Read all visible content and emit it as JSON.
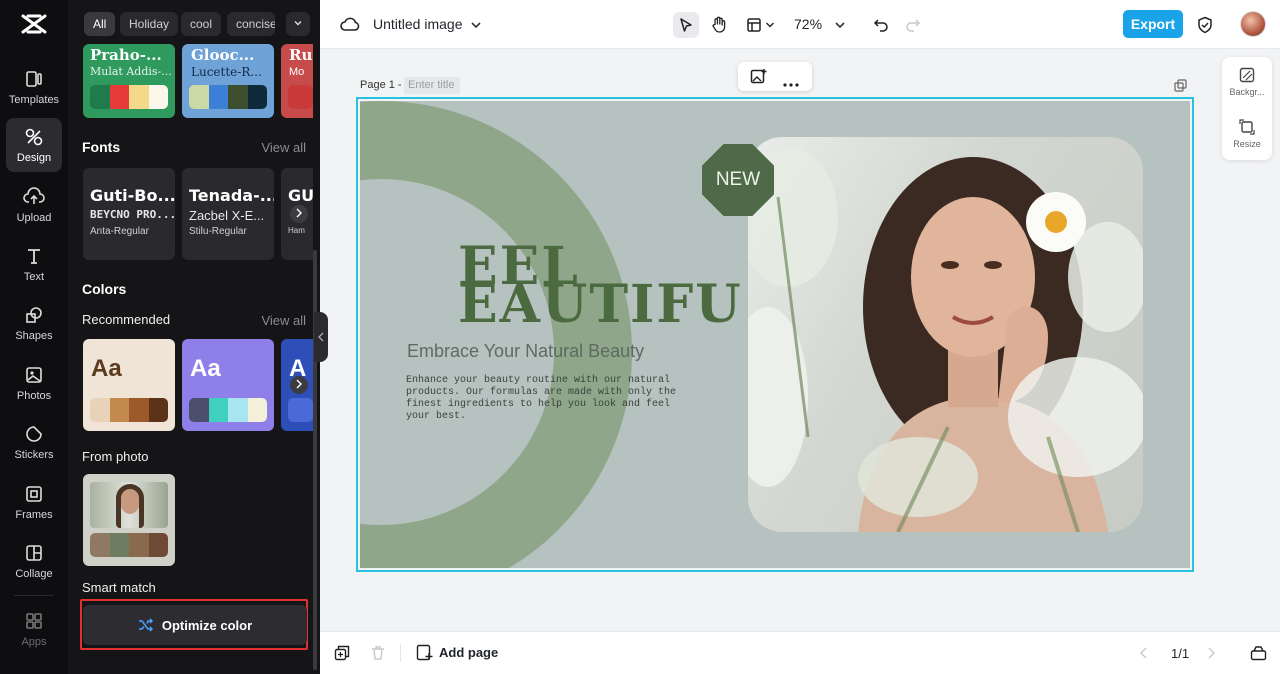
{
  "rail": {
    "items": [
      {
        "label": "Templates",
        "icon": "templates-icon"
      },
      {
        "label": "Design",
        "icon": "design-icon"
      },
      {
        "label": "Upload",
        "icon": "upload-icon"
      },
      {
        "label": "Text",
        "icon": "text-icon"
      },
      {
        "label": "Shapes",
        "icon": "shapes-icon"
      },
      {
        "label": "Photos",
        "icon": "photos-icon"
      },
      {
        "label": "Stickers",
        "icon": "stickers-icon"
      },
      {
        "label": "Frames",
        "icon": "frames-icon"
      },
      {
        "label": "Collage",
        "icon": "collage-icon"
      },
      {
        "label": "Apps",
        "icon": "apps-icon"
      }
    ],
    "active": "Design"
  },
  "panel": {
    "chips": [
      "All",
      "Holiday",
      "cool",
      "concise"
    ],
    "theme_cards": [
      {
        "font": "Praho-...",
        "sub": "Mulat Addis-...",
        "bg": "#2f9a5d",
        "swatches": [
          "#1f7a4c",
          "#e63b3b",
          "#f5d98a",
          "#fbf7ea"
        ]
      },
      {
        "font": "Glooc...",
        "sub": "Lucette-R...",
        "bg": "#6fa3d8",
        "swatches": [
          "#cbd9a6",
          "#3c7fd6",
          "#3e4f2f",
          "#0f2a3b"
        ]
      },
      {
        "font": "Ru",
        "sub": "Mo",
        "bg": "#c84b4b",
        "swatches": [
          "#c93a3a"
        ]
      }
    ],
    "fonts": {
      "title": "Fonts",
      "view_all": "View all",
      "cards": [
        {
          "line1": "Guti-Bo...",
          "line2": "BEYCNO PRO...",
          "line3": "Anta-Regular"
        },
        {
          "line1": "Tenada-...",
          "line2": "Zacbel X-E...",
          "line3": "Stilu-Regular"
        },
        {
          "line1": "GU",
          "line2": "",
          "line3": "Ham"
        }
      ]
    },
    "colors": {
      "title": "Colors",
      "recommended": "Recommended",
      "view_all": "View all",
      "cards": [
        {
          "label": "Aa",
          "bg": "#efe4d6",
          "fg": "#5b3a1e",
          "swatches": [
            "#e8d3b8",
            "#c48a4d",
            "#9c5a2b",
            "#5c3218"
          ]
        },
        {
          "label": "Aa",
          "bg": "#8f7fe8",
          "fg": "#ffffff",
          "swatches": [
            "#4b4f6b",
            "#3fd0c0",
            "#a8e6ef",
            "#f3efd8"
          ]
        },
        {
          "label": "A",
          "bg": "#2f4fb8",
          "fg": "#ffffff",
          "swatches": [
            "#4a6ad8"
          ]
        }
      ]
    },
    "from_photo": {
      "title": "From photo",
      "swatches": [
        "#8e7a63",
        "#6e7c62",
        "#8a6a4c",
        "#6e4a34"
      ]
    },
    "smart_match": {
      "title": "Smart match",
      "button": "Optimize color"
    }
  },
  "topbar": {
    "doc_title": "Untitled image",
    "zoom": "72%",
    "export": "Export"
  },
  "canvas_area": {
    "page_label": "Page 1 -",
    "title_placeholder": "Enter title",
    "side_tools": [
      "Backgr...",
      "Resize"
    ]
  },
  "design": {
    "badge": "NEW",
    "headline_1": "EEL",
    "headline_2": "EAUTIFU",
    "subtitle": "Embrace Your Natural Beauty",
    "paragraph": "Enhance your beauty routine with our natural products. Our formulas are made with only the finest ingredients to help you look and feel your best."
  },
  "bottombar": {
    "add_page": "Add page",
    "page_count": "1/1"
  }
}
